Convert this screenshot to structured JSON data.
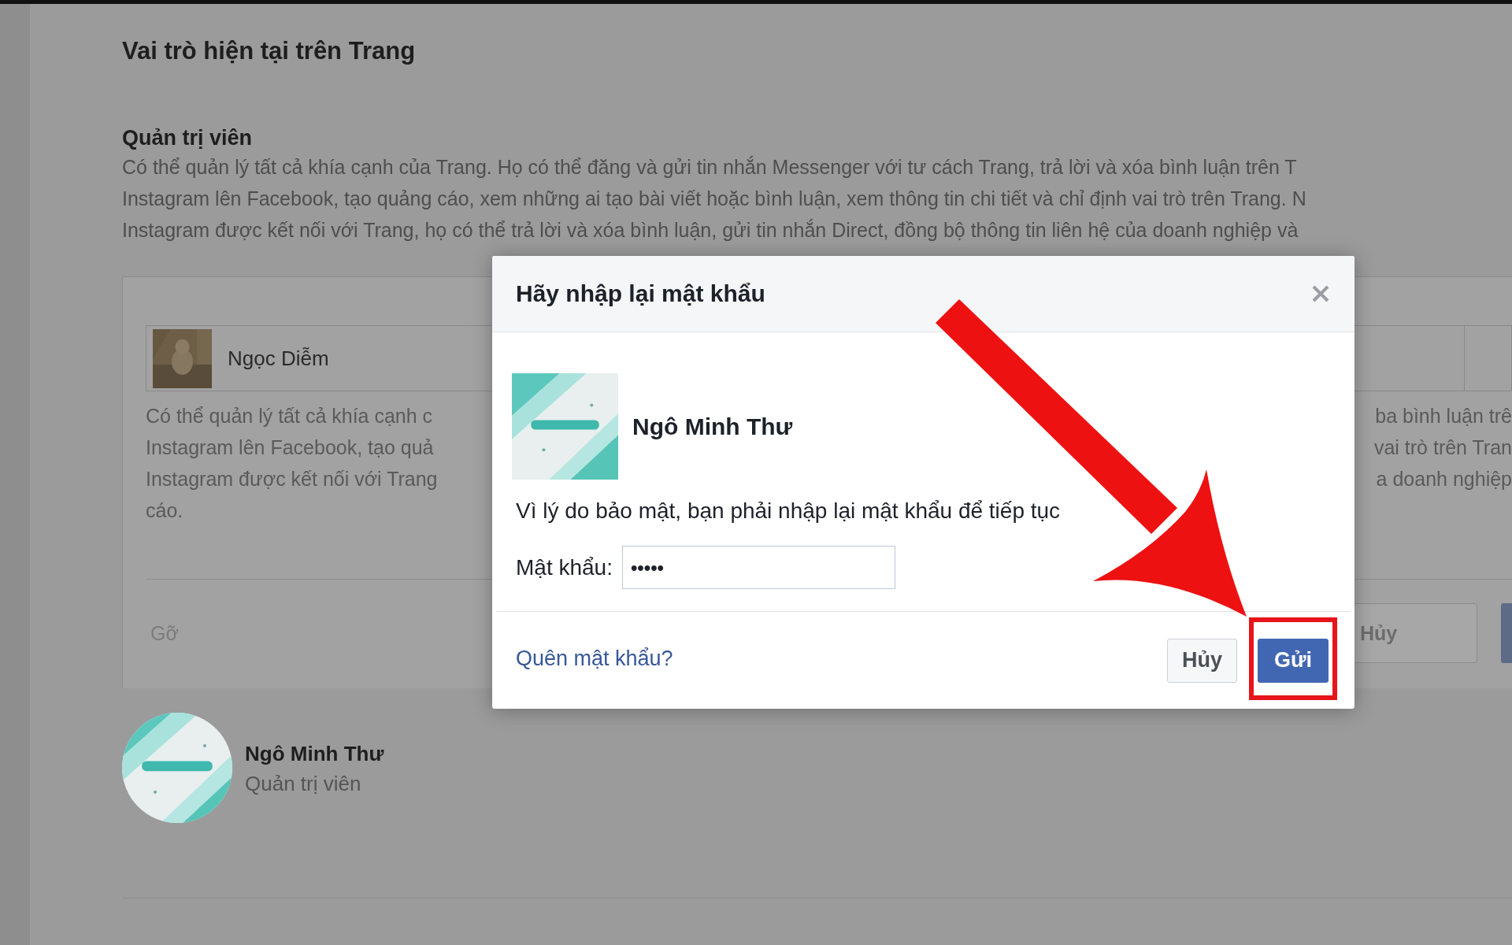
{
  "page": {
    "title": "Vai trò hiện tại trên Trang"
  },
  "role_section": {
    "title": "Quản trị viên",
    "description_lines": [
      "Có thể quản lý tất cả khía cạnh của Trang. Họ có thể đăng và gửi tin nhắn Messenger với tư cách Trang, trả lời và xóa bình luận trên T",
      "Instagram lên Facebook, tạo quảng cáo, xem những ai tạo bài viết hoặc bình luận, xem thông tin chi tiết và chỉ định vai trò trên Trang. N",
      "Instagram được kết nối với Trang, họ có thể trả lời và xóa bình luận, gửi tin nhắn Direct, đồng bộ thông tin liên hệ của doanh nghiệp và"
    ]
  },
  "pending_card": {
    "person_name": "Ngọc Diễm",
    "description_left": [
      "Có thể quản lý tất cả khía cạnh c",
      "Instagram lên Facebook, tạo quả",
      "Instagram được kết nối với Trang",
      "cáo."
    ],
    "description_right": [
      "ba bình luận trê",
      "vai trò trên Tran",
      "a doanh nghiệp"
    ],
    "remove_label": "Gỡ",
    "cancel_button": "Hủy"
  },
  "current_admin": {
    "name": "Ngô Minh Thư",
    "role": "Quản trị viên"
  },
  "dialog": {
    "title": "Hãy nhập lại mật khẩu",
    "user_name": "Ngô Minh Thư",
    "message": "Vì lý do bảo mật, bạn phải nhập lại mật khẩu để tiếp tục",
    "password_label": "Mật khẩu:",
    "password_value": "•••••",
    "forgot_link": "Quên mật khẩu?",
    "buttons": [
      {
        "label": "Hủy",
        "kind": "secondary",
        "highlighted": false
      },
      {
        "label": "Gửi",
        "kind": "primary",
        "highlighted": true
      }
    ]
  }
}
